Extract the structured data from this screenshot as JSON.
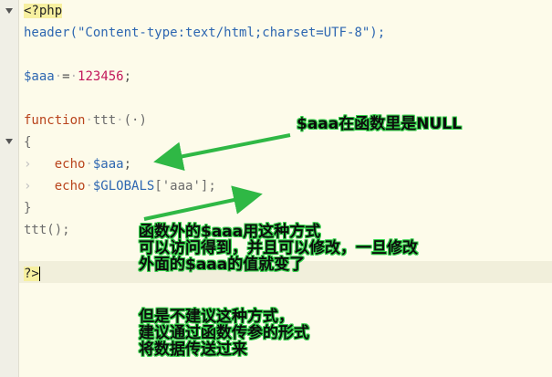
{
  "editor": {
    "lines": [
      {
        "parts": [
          {
            "t": "<?php",
            "c": "tag"
          }
        ]
      },
      {
        "parts": [
          {
            "t": "header",
            "c": "fn"
          },
          {
            "t": "(\"Content-type:text/html;charset=UTF-8\");",
            "c": "str"
          }
        ]
      },
      {
        "parts": []
      },
      {
        "parts": [
          {
            "t": "$aaa",
            "c": "var"
          },
          {
            "t": "·",
            "c": "dot"
          },
          {
            "t": "=",
            "c": "op"
          },
          {
            "t": "·",
            "c": "dot"
          },
          {
            "t": "123456",
            "c": "num"
          },
          {
            "t": ";",
            "c": "op"
          }
        ]
      },
      {
        "parts": []
      },
      {
        "parts": [
          {
            "t": "function",
            "c": "kw"
          },
          {
            "t": "·",
            "c": "dot"
          },
          {
            "t": "ttt",
            "c": "plain"
          },
          {
            "t": "·",
            "c": "dot"
          },
          {
            "t": "(·)",
            "c": "plain"
          }
        ]
      },
      {
        "parts": [
          {
            "t": "{",
            "c": "plain"
          }
        ]
      },
      {
        "parts": [
          {
            "t": "›   ",
            "c": "tab"
          },
          {
            "t": "echo",
            "c": "kw"
          },
          {
            "t": "·",
            "c": "dot"
          },
          {
            "t": "$aaa",
            "c": "var"
          },
          {
            "t": ";",
            "c": "op"
          }
        ]
      },
      {
        "parts": [
          {
            "t": "›   ",
            "c": "tab"
          },
          {
            "t": "echo",
            "c": "kw"
          },
          {
            "t": "·",
            "c": "dot"
          },
          {
            "t": "$GLOBALS",
            "c": "var"
          },
          {
            "t": "['aaa'];",
            "c": "plain"
          }
        ]
      },
      {
        "parts": [
          {
            "t": "}",
            "c": "plain"
          }
        ]
      },
      {
        "parts": [
          {
            "t": "ttt();",
            "c": "plain"
          }
        ]
      },
      {
        "parts": []
      },
      {
        "parts": [
          {
            "t": "?>",
            "c": "tag"
          }
        ],
        "caret": true
      }
    ]
  },
  "annotations": {
    "null_note": "$aaa在函数里是NULL",
    "globals_note": "函数外的$aaa用这种方式\n可以访问得到，并且可以修改，一旦修改\n外面的$aaa的值就变了",
    "advice_note": "但是不建议这种方式，\n建议通过函数传参的形式\n将数据传送过来"
  },
  "colors": {
    "background": "#fdfbea",
    "gutter": "#f0efe6",
    "arrow_green": "#2fb845",
    "annotation_outline": "#35d14a"
  }
}
